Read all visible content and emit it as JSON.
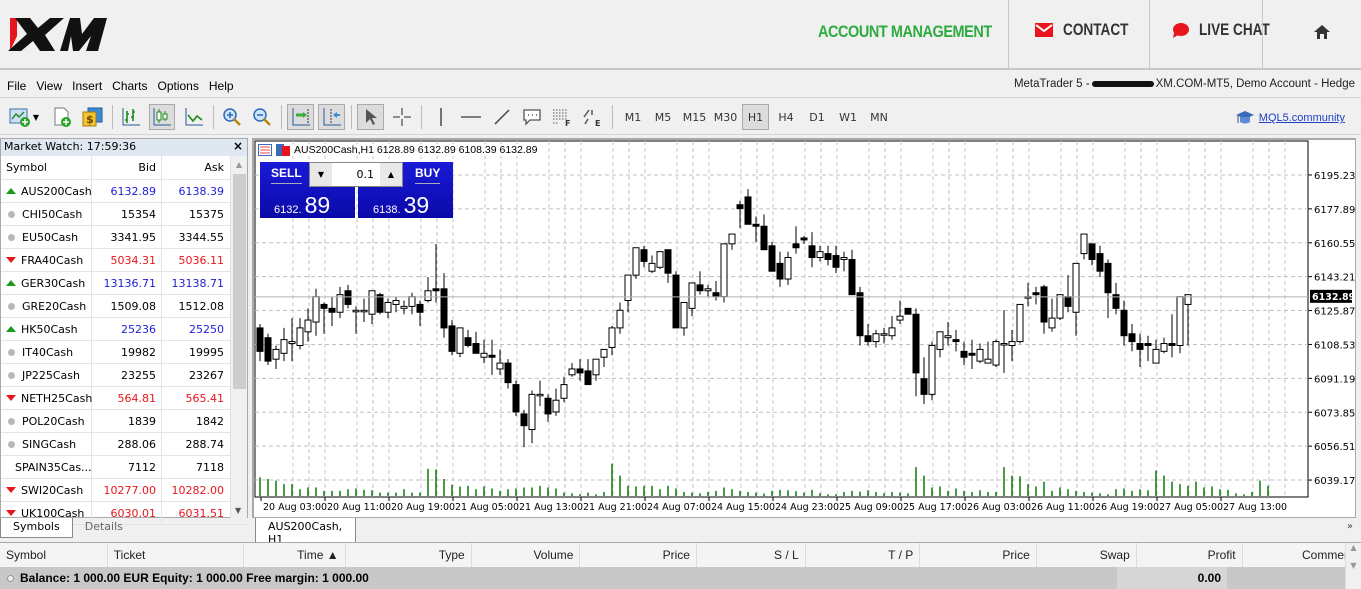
{
  "brand": {
    "logo": "XM",
    "nav": [
      {
        "label": "ACCOUNT MANAGEMENT",
        "icon": null,
        "color": "#2eab3f"
      },
      {
        "label": "CONTACT",
        "icon": "envelope-icon"
      },
      {
        "label": "LIVE CHAT",
        "icon": "chat-bubble-icon"
      },
      {
        "label": "",
        "icon": "home-icon"
      }
    ]
  },
  "menu": [
    "File",
    "View",
    "Insert",
    "Charts",
    "Options",
    "Help"
  ],
  "account_info": {
    "prefix": "MetaTrader 5 -",
    "suffix": "XM.COM-MT5, Demo Account - Hedge"
  },
  "toolbar": {
    "tools": [
      "new-chart-icon",
      "new-order-icon",
      "trading-icon",
      "bar-chart-icon",
      "candlestick-chart-icon",
      "line-chart-icon",
      "zoom-in-icon",
      "zoom-out-icon",
      "autoscroll-icon",
      "chart-shift-icon",
      "cursor-icon",
      "crosshair-icon",
      "vertical-line-icon",
      "horizontal-line-icon",
      "trendline-icon",
      "text-label-icon",
      "fibonacci-icon",
      "elliott-wave-icon"
    ],
    "timeframes": [
      "M1",
      "M5",
      "M15",
      "M30",
      "H1",
      "H4",
      "D1",
      "W1",
      "MN"
    ],
    "active_timeframe": "H1",
    "community_link": "MQL5.community"
  },
  "market_watch": {
    "title": "Market Watch: 17:59:36",
    "columns": [
      "Symbol",
      "Bid",
      "Ask"
    ],
    "rows": [
      {
        "symbol": "AUS200Cash",
        "bid": "6132.89",
        "ask": "6138.39",
        "dir": "up"
      },
      {
        "symbol": "CHI50Cash",
        "bid": "15354",
        "ask": "15375",
        "dir": "flat"
      },
      {
        "symbol": "EU50Cash",
        "bid": "3341.95",
        "ask": "3344.55",
        "dir": "flat"
      },
      {
        "symbol": "FRA40Cash",
        "bid": "5034.31",
        "ask": "5036.11",
        "dir": "down"
      },
      {
        "symbol": "GER30Cash",
        "bid": "13136.71",
        "ask": "13138.71",
        "dir": "up"
      },
      {
        "symbol": "GRE20Cash",
        "bid": "1509.08",
        "ask": "1512.08",
        "dir": "flat"
      },
      {
        "symbol": "HK50Cash",
        "bid": "25236",
        "ask": "25250",
        "dir": "up"
      },
      {
        "symbol": "IT40Cash",
        "bid": "19982",
        "ask": "19995",
        "dir": "flat"
      },
      {
        "symbol": "JP225Cash",
        "bid": "23255",
        "ask": "23267",
        "dir": "flat"
      },
      {
        "symbol": "NETH25Cash",
        "bid": "564.81",
        "ask": "565.41",
        "dir": "down"
      },
      {
        "symbol": "POL20Cash",
        "bid": "1839",
        "ask": "1842",
        "dir": "flat"
      },
      {
        "symbol": "SINGCash",
        "bid": "288.06",
        "ask": "288.74",
        "dir": "flat"
      },
      {
        "symbol": "SPAIN35Cas...",
        "bid": "7112",
        "ask": "7118",
        "dir": "flat"
      },
      {
        "symbol": "SWI20Cash",
        "bid": "10277.00",
        "ask": "10282.00",
        "dir": "down"
      },
      {
        "symbol": "UK100Cash",
        "bid": "6030.01",
        "ask": "6031.51",
        "dir": "down"
      }
    ],
    "tabs": [
      "Symbols",
      "Details"
    ],
    "active_tab": "Symbols"
  },
  "chart": {
    "header": "AUS200Cash,H1  6128.89 6132.89 6108.39 6132.89",
    "one_click": {
      "sell_label": "SELL",
      "buy_label": "BUY",
      "lot": "0.1",
      "sell_small": "6132.",
      "sell_big": "89",
      "buy_small": "6138.",
      "buy_big": "39"
    },
    "tab_label": "AUS200Cash, H1"
  },
  "chart_data": {
    "type": "candlestick",
    "symbol": "AUS200Cash",
    "timeframe": "H1",
    "current_price": 6132.89,
    "current_price_label": "6132.89",
    "ylim": [
      6030.5,
      6212.6
    ],
    "yticks": [
      "6195.23",
      "6177.89",
      "6160.55",
      "6143.21",
      "6125.87",
      "6108.53",
      "6091.19",
      "6073.85",
      "6056.51",
      "6039.17"
    ],
    "xticks": [
      "20 Aug 03:00",
      "20 Aug 11:00",
      "20 Aug 19:00",
      "21 Aug 05:00",
      "21 Aug 13:00",
      "21 Aug 21:00",
      "24 Aug 07:00",
      "24 Aug 15:00",
      "24 Aug 23:00",
      "25 Aug 09:00",
      "25 Aug 17:00",
      "26 Aug 03:00",
      "26 Aug 11:00",
      "26 Aug 19:00",
      "27 Aug 05:00",
      "27 Aug 13:00"
    ],
    "grid": true,
    "volume_color": "#0a7a0a",
    "ohlc": [
      [
        6117,
        6119,
        6100,
        6105
      ],
      [
        6112,
        6114,
        6098,
        6100
      ],
      [
        6101,
        6108,
        6096,
        6106
      ],
      [
        6104,
        6117,
        6100,
        6111
      ],
      [
        6109,
        6122,
        6100,
        6110
      ],
      [
        6108,
        6122,
        6106,
        6117
      ],
      [
        6115,
        6127,
        6110,
        6121
      ],
      [
        6120,
        6137,
        6113,
        6133
      ],
      [
        6129,
        6130,
        6114,
        6127
      ],
      [
        6127,
        6133,
        6118,
        6125
      ],
      [
        6125,
        6138,
        6122,
        6134
      ],
      [
        6136,
        6139,
        6127,
        6129
      ],
      [
        6126,
        6128,
        6114,
        6126
      ],
      [
        6126,
        6132,
        6120,
        6126
      ],
      [
        6124,
        6136,
        6119,
        6136
      ],
      [
        6134,
        6135,
        6124,
        6125
      ],
      [
        6125,
        6132,
        6122,
        6130
      ],
      [
        6129,
        6133,
        6125,
        6131
      ],
      [
        6127,
        6131,
        6124,
        6128
      ],
      [
        6128,
        6135,
        6124,
        6133
      ],
      [
        6129,
        6131,
        6118,
        6125
      ],
      [
        6131,
        6143,
        6130,
        6136
      ],
      [
        6137,
        6160,
        6130,
        6136
      ],
      [
        6137,
        6145,
        6112,
        6117
      ],
      [
        6118,
        6121,
        6103,
        6105
      ],
      [
        6104,
        6116,
        6102,
        6117
      ],
      [
        6112,
        6116,
        6107,
        6108
      ],
      [
        6109,
        6115,
        6106,
        6104
      ],
      [
        6102,
        6111,
        6099,
        6104
      ],
      [
        6103,
        6111,
        6093,
        6102
      ],
      [
        6096,
        6106,
        6093,
        6099
      ],
      [
        6099,
        6101,
        6086,
        6089
      ],
      [
        6088,
        6090,
        6072,
        6074
      ],
      [
        6073,
        6075,
        6056,
        6067
      ],
      [
        6065,
        6085,
        6058,
        6083
      ],
      [
        6083,
        6090,
        6077,
        6083
      ],
      [
        6081,
        6083,
        6069,
        6073
      ],
      [
        6074,
        6086,
        6072,
        6080
      ],
      [
        6081,
        6092,
        6079,
        6088
      ],
      [
        6093,
        6099,
        6092,
        6096
      ],
      [
        6096,
        6101,
        6090,
        6094
      ],
      [
        6095,
        6101,
        6089,
        6088
      ],
      [
        6093,
        6101,
        6090,
        6101
      ],
      [
        6102,
        6106,
        6097,
        6106
      ],
      [
        6107,
        6118,
        6103,
        6117
      ],
      [
        6117,
        6130,
        6114,
        6126
      ],
      [
        6131,
        6142,
        6125,
        6144
      ],
      [
        6144,
        6156,
        6142,
        6158
      ],
      [
        6157,
        6159,
        6148,
        6151
      ],
      [
        6146,
        6154,
        6145,
        6150
      ],
      [
        6148,
        6156,
        6147,
        6156
      ],
      [
        6157,
        6155,
        6140,
        6145
      ],
      [
        6144,
        6146,
        6118,
        6117
      ],
      [
        6117,
        6118,
        6113,
        6130
      ],
      [
        6127,
        6140,
        6123,
        6140
      ],
      [
        6139,
        6146,
        6134,
        6136
      ],
      [
        6136,
        6139,
        6133,
        6137
      ],
      [
        6135,
        6141,
        6131,
        6133
      ],
      [
        6133,
        6142,
        6130,
        6160
      ],
      [
        6160,
        6164,
        6157,
        6165
      ],
      [
        6180,
        6182,
        6168,
        6178
      ],
      [
        6184,
        6188,
        6173,
        6170
      ],
      [
        6170,
        6174,
        6161,
        6169
      ],
      [
        6169,
        6175,
        6160,
        6157
      ],
      [
        6159,
        6161,
        6147,
        6146
      ],
      [
        6150,
        6156,
        6138,
        6142
      ],
      [
        6142,
        6156,
        6139,
        6153
      ],
      [
        6160,
        6169,
        6155,
        6158
      ],
      [
        6163,
        6164,
        6160,
        6162
      ],
      [
        6159,
        6166,
        6148,
        6153
      ],
      [
        6153,
        6159,
        6151,
        6156
      ],
      [
        6155,
        6159,
        6149,
        6152
      ],
      [
        6154,
        6159,
        6145,
        6148
      ],
      [
        6152,
        6156,
        6146,
        6153
      ],
      [
        6152,
        6157,
        6137,
        6134
      ],
      [
        6135,
        6138,
        6108,
        6113
      ],
      [
        6113,
        6119,
        6108,
        6110
      ],
      [
        6110,
        6116,
        6107,
        6114
      ],
      [
        6114,
        6117,
        6109,
        6114
      ],
      [
        6113,
        6123,
        6111,
        6117
      ],
      [
        6121,
        6131,
        6119,
        6123
      ],
      [
        6127,
        6127,
        6125,
        6124
      ],
      [
        6124,
        6127,
        6082,
        6094
      ],
      [
        6091,
        6102,
        6078,
        6083
      ],
      [
        6083,
        6110,
        6080,
        6108
      ],
      [
        6106,
        6114,
        6102,
        6115
      ],
      [
        6112,
        6120,
        6108,
        6113
      ],
      [
        6111,
        6116,
        6105,
        6110
      ],
      [
        6105,
        6110,
        6098,
        6102
      ],
      [
        6104,
        6111,
        6096,
        6103
      ],
      [
        6100,
        6109,
        6099,
        6106
      ],
      [
        6099,
        6110,
        6099,
        6101
      ],
      [
        6098,
        6111,
        6097,
        6110
      ],
      [
        6109,
        6126,
        6094,
        6109
      ],
      [
        6108,
        6116,
        6100,
        6110
      ],
      [
        6110,
        6128,
        6109,
        6129
      ],
      [
        6133,
        6140,
        6128,
        6133
      ],
      [
        6135,
        6138,
        6129,
        6134
      ],
      [
        6138,
        6139,
        6114,
        6120
      ],
      [
        6117,
        6132,
        6115,
        6122
      ],
      [
        6122,
        6133,
        6121,
        6134
      ],
      [
        6133,
        6144,
        6125,
        6128
      ],
      [
        6125,
        6150,
        6113,
        6150
      ],
      [
        6155,
        6159,
        6152,
        6165
      ],
      [
        6160,
        6159,
        6149,
        6152
      ],
      [
        6155,
        6159,
        6143,
        6146
      ],
      [
        6150,
        6152,
        6122,
        6135
      ],
      [
        6134,
        6140,
        6124,
        6127
      ],
      [
        6126,
        6131,
        6108,
        6113
      ],
      [
        6114,
        6119,
        6105,
        6110
      ],
      [
        6109,
        6114,
        6097,
        6106
      ],
      [
        6109,
        6113,
        6100,
        6108
      ],
      [
        6099,
        6111,
        6099,
        6106
      ],
      [
        6105,
        6112,
        6104,
        6109
      ],
      [
        6109,
        6124,
        6102,
        6108
      ],
      [
        6108,
        6129,
        6104,
        6133
      ],
      [
        6129,
        6134,
        6108,
        6134
      ]
    ],
    "volume": [
      0.55,
      0.5,
      0.45,
      0.35,
      0.35,
      0.2,
      0.25,
      0.25,
      0.15,
      0.15,
      0.15,
      0.2,
      0.22,
      0.18,
      0.17,
      0.1,
      0.1,
      0.1,
      0.2,
      0.1,
      0.1,
      0.8,
      0.78,
      0.5,
      0.33,
      0.28,
      0.3,
      0.2,
      0.28,
      0.22,
      0.15,
      0.2,
      0.22,
      0.25,
      0.25,
      0.3,
      0.25,
      0.22,
      0.1,
      0.08,
      0.05,
      0.1,
      0.05,
      0.12,
      0.95,
      0.6,
      0.3,
      0.28,
      0.3,
      0.3,
      0.2,
      0.3,
      0.22,
      0.12,
      0.1,
      0.08,
      0.12,
      0.15,
      0.25,
      0.2,
      0.15,
      0.12,
      0.1,
      0.07,
      0.15,
      0.18,
      0.17,
      0.14,
      0.1,
      0.18,
      0.08,
      0.05,
      0.05,
      0.12,
      0.15,
      0.13,
      0.17,
      0.12,
      0.08,
      0.12,
      0.1,
      0.08,
      0.85,
      0.6,
      0.25,
      0.28,
      0.15,
      0.22,
      0.15,
      0.12,
      0.17,
      0.12,
      0.12,
      0.85,
      0.6,
      0.58,
      0.35,
      0.28,
      0.42,
      0.15,
      0.25,
      0.2,
      0.15,
      0.12,
      0.1,
      0.08,
      0.05,
      0.2,
      0.22,
      0.15,
      0.2,
      0.17,
      0.75,
      0.6,
      0.42,
      0.35,
      0.3,
      0.42,
      0.25,
      0.28,
      0.2,
      0.18,
      0.08,
      0.05,
      0.12,
      0.45,
      0.3
    ]
  },
  "terminal": {
    "columns": [
      "Symbol",
      "Ticket",
      "Time ▲",
      "Type",
      "Volume",
      "Price",
      "S / L",
      "T / P",
      "Price",
      "Swap",
      "Profit",
      "Comment"
    ],
    "summary": "Balance: 1 000.00 EUR  Equity: 1 000.00  Free margin: 1 000.00",
    "profit": "0.00"
  }
}
